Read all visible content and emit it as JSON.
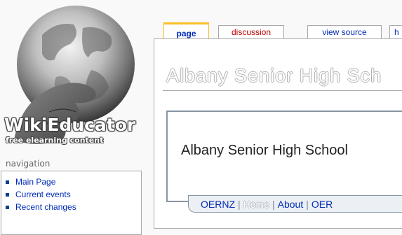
{
  "logo": {
    "title": "WikiEducator",
    "subtitle": "free elearning content"
  },
  "navigation": {
    "heading": "navigation",
    "items": [
      {
        "label": "Main Page"
      },
      {
        "label": "Current events"
      },
      {
        "label": "Recent changes"
      }
    ]
  },
  "tabs": [
    {
      "label": "page",
      "selected": true
    },
    {
      "label": "discussion",
      "selected": false
    },
    {
      "label": "view source",
      "selected": false
    },
    {
      "label": "h",
      "selected": false
    }
  ],
  "content": {
    "heading": "Albany Senior High Sch",
    "banner_title": "Albany Senior High School",
    "menu": {
      "items": [
        "OERNZ",
        "Home",
        "About",
        "OER"
      ],
      "separator": "|"
    }
  },
  "colors": {
    "link": "#002bb8",
    "new_link": "#ba0000",
    "selected_tab_border": "#fabd23",
    "banner_border": "#8895a4",
    "menu_background": "#eceff3"
  }
}
